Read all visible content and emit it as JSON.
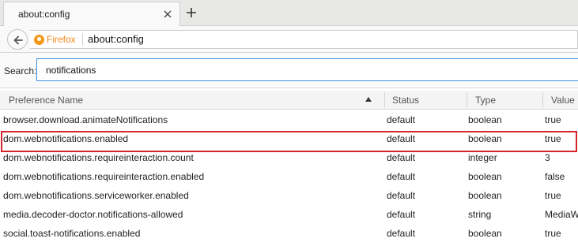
{
  "tab": {
    "title": "about:config"
  },
  "navbar": {
    "identity_label": "Firefox",
    "url": "about:config"
  },
  "search": {
    "label": "Search:",
    "value": "notifications"
  },
  "table": {
    "columns": [
      "Preference Name",
      "Status",
      "Type",
      "Value"
    ],
    "rows": [
      {
        "name": "browser.download.animateNotifications",
        "status": "default",
        "type": "boolean",
        "value": "true"
      },
      {
        "name": "dom.webnotifications.enabled",
        "status": "default",
        "type": "boolean",
        "value": "true"
      },
      {
        "name": "dom.webnotifications.requireinteraction.count",
        "status": "default",
        "type": "integer",
        "value": "3"
      },
      {
        "name": "dom.webnotifications.requireinteraction.enabled",
        "status": "default",
        "type": "boolean",
        "value": "false"
      },
      {
        "name": "dom.webnotifications.serviceworker.enabled",
        "status": "default",
        "type": "boolean",
        "value": "true"
      },
      {
        "name": "media.decoder-doctor.notifications-allowed",
        "status": "default",
        "type": "string",
        "value": "MediaW"
      },
      {
        "name": "social.toast-notifications.enabled",
        "status": "default",
        "type": "boolean",
        "value": "true"
      }
    ]
  },
  "colors": {
    "accent_blue": "#3a8fe0",
    "highlight_red": "#d3262c",
    "firefox_orange": "#f5871f"
  },
  "icons": {
    "close": "close-icon",
    "new_tab": "plus-icon",
    "back": "back-arrow-icon",
    "identity": "firefox-logo-icon",
    "sort": "sort-ascending-icon"
  }
}
